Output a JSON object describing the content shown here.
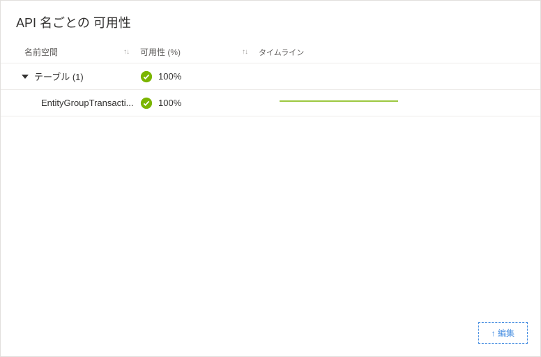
{
  "title": "API 名ごとの 可用性",
  "columns": {
    "namespace": "名前空間",
    "availability": "可用性 (%)",
    "timeline": "タイムライン"
  },
  "rows": [
    {
      "group": true,
      "label": "テーブル (1)",
      "availability": "100%"
    },
    {
      "group": false,
      "label": "EntityGroupTransacti...",
      "availability": "100%"
    }
  ],
  "edit_button": "↑ 編集",
  "icons": {
    "check": "check-circle",
    "sort": "sort-arrows",
    "expand": "caret-down"
  },
  "colors": {
    "success": "#7bb500",
    "accent": "#4a90e2"
  }
}
